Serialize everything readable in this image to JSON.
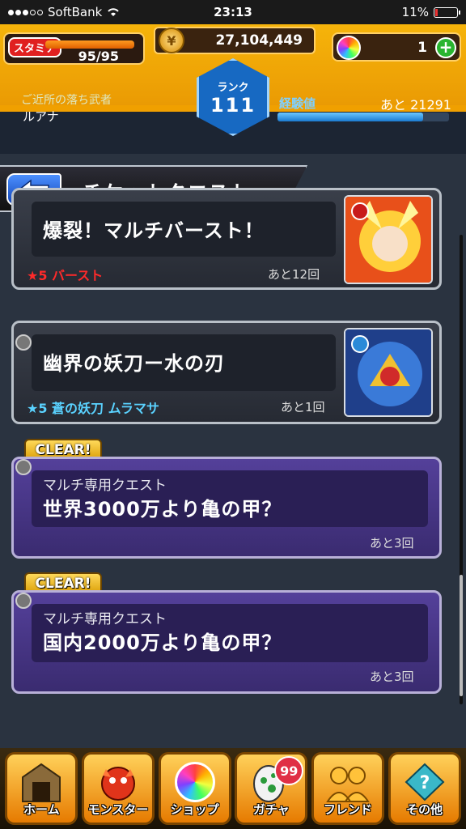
{
  "status_bar": {
    "carrier": "SoftBank",
    "time": "23:13",
    "battery": "11%"
  },
  "header": {
    "stamina_label": "スタミナ",
    "stamina_value": "95/95",
    "stamina_fill": 1.0,
    "gold": "27,104,449",
    "orbs": "1",
    "orb_add_label": "+",
    "rank_label": "ランク",
    "rank_value": "111",
    "title_name": "ご近所の落ち武者",
    "player_name": "ルアナ",
    "exp_label": "経験値",
    "exp_remaining": "あと 21291",
    "exp_fill": 0.85
  },
  "page": {
    "title": "チケットクエスト"
  },
  "quests": [
    {
      "name": "爆裂！マルチバースト！",
      "reward": "★5 バースト",
      "reward_color": "#ff2a2a",
      "remaining": "あと12回"
    },
    {
      "name": "幽界の妖刀ー水の刃",
      "reward": "★5 蒼の妖刀 ムラマサ",
      "reward_color": "#5ad2ff",
      "remaining": "あと1回"
    },
    {
      "badge": "CLEAR!",
      "category": "マルチ専用クエスト",
      "name": "世界3000万より亀の甲？",
      "remaining": "あと3回"
    },
    {
      "badge": "CLEAR!",
      "category": "マルチ専用クエスト",
      "name": "国内2000万より亀の甲？",
      "remaining": "あと3回"
    }
  ],
  "nav": {
    "home": "ホーム",
    "monster": "モンスター",
    "shop": "ショップ",
    "gacha": "ガチャ",
    "gacha_badge": "99",
    "friend": "フレンド",
    "other": "その他"
  },
  "colors": {
    "header_orange": "#f6b40a",
    "rank_blue": "#1769c2",
    "multi_purple": "#54409a",
    "nav_orange": "#ffd15a"
  }
}
